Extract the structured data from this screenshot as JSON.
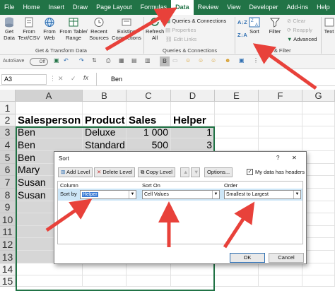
{
  "tabs": [
    "File",
    "Home",
    "Insert",
    "Draw",
    "Page Layout",
    "Formulas",
    "Data",
    "Review",
    "View",
    "Developer",
    "Add-ins",
    "Help"
  ],
  "active_tab": "Data",
  "ribbon": {
    "get_data": "Get",
    "get_data2": "Data",
    "from_text": "From",
    "from_text2": "Text/CSV",
    "from_web": "From",
    "from_web2": "Web",
    "from_table": "From Table/",
    "from_table2": "Range",
    "recent": "Recent",
    "recent2": "Sources",
    "existing": "Existing",
    "existing2": "Connections",
    "refresh": "Refresh",
    "refresh2": "All",
    "queries": "Queries & Connections",
    "properties": "Properties",
    "edit_links": "Edit Links",
    "sort": "Sort",
    "filter": "Filter",
    "clear": "Clear",
    "reapply": "Reapply",
    "advanced": "Advanced",
    "text_to": "Text",
    "group1": "Get & Transform Data",
    "group2": "Queries & Connections",
    "group3": "Sort & Filter"
  },
  "qat": {
    "autosave": "AutoSave",
    "toggle": "Off"
  },
  "formula_bar": {
    "name_box": "A3",
    "fx": "fx",
    "value": "Ben"
  },
  "columns": [
    "A",
    "B",
    "C",
    "D",
    "E",
    "F",
    "G"
  ],
  "rows": [
    "1",
    "2",
    "3",
    "4",
    "5",
    "6",
    "7",
    "8",
    "9",
    "10",
    "11",
    "12",
    "13",
    "14",
    "15"
  ],
  "cells": {
    "a2": "Salesperson",
    "b2": "Product",
    "c2": "Sales",
    "d2": "Helper",
    "a3": "Ben",
    "b3": "Deluxe",
    "c3": "1 000",
    "d3": "1",
    "a4": "Ben",
    "b4": "Standard",
    "c4": "500",
    "d4": "3",
    "a5": "Ben",
    "a6": "Mary",
    "a7": "Susan",
    "a8": "Susan",
    "a9": "---",
    "a10": "---",
    "a11": "---",
    "a12": "---",
    "a13": "---"
  },
  "dialog": {
    "title": "Sort",
    "help": "?",
    "close": "✕",
    "add_level": "Add Level",
    "delete_level": "Delete Level",
    "copy_level": "Copy Level",
    "options": "Options...",
    "headers_label": "My data has headers",
    "col_header": "Column",
    "sorton_header": "Sort On",
    "order_header": "Order",
    "sort_by": "Sort by",
    "column_value": "Helper",
    "sorton_value": "Cell Values",
    "order_value": "Smallest to Largest",
    "ok": "OK",
    "cancel": "Cancel"
  },
  "colors": {
    "excel_green": "#217346",
    "arrow_red": "#e8413a",
    "selection_gray": "#d6d6d6"
  }
}
